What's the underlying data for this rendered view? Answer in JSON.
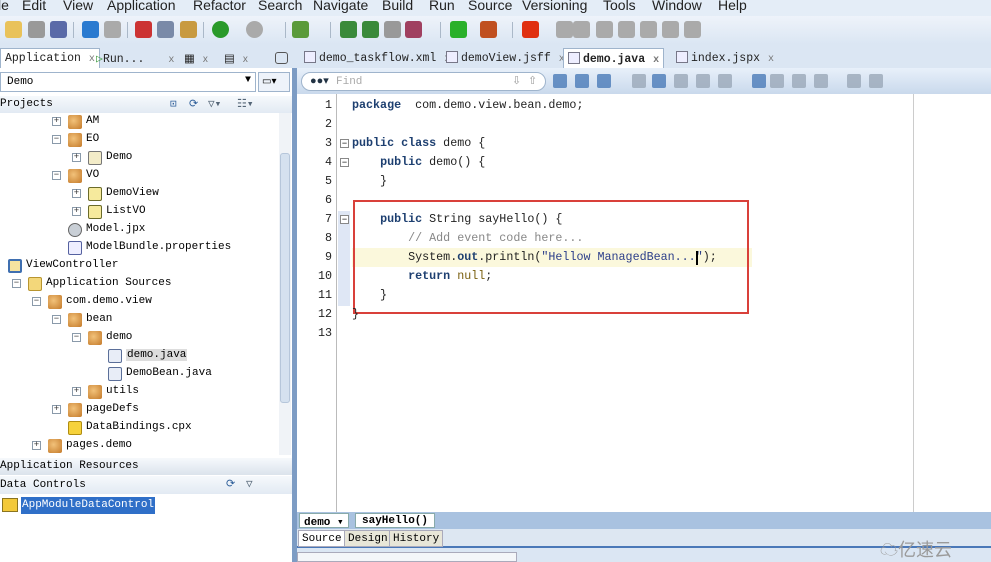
{
  "menubar": {
    "items": [
      "le",
      "Edit",
      "View",
      "Application",
      "Refactor",
      "Search",
      "Navigate",
      "Build",
      "Run",
      "Source",
      "Versioning",
      "Tools",
      "Window",
      "Help"
    ]
  },
  "toolbar": {
    "icons": [
      "open-icon",
      "save-icon",
      "save-all-icon",
      "undo-icon",
      "redo-icon",
      "cut-icon",
      "copy-icon",
      "paste-icon",
      "back-icon",
      "forward-icon",
      "sql-icon",
      "deploy-icon",
      "deploy-all-icon",
      "build-icon",
      "debug-profile-icon",
      "run-icon",
      "debug-icon",
      "stop-icon",
      "step-icon",
      "step-over-icon",
      "step-into-icon",
      "step-out-icon",
      "resume-icon",
      "pause-icon",
      "trash-icon"
    ]
  },
  "left_panel": {
    "tabs": [
      {
        "label": "Application"
      },
      {
        "label": "Run..."
      }
    ],
    "app_selector": "Demo",
    "projects_label": "Projects",
    "tree": [
      {
        "level": 3,
        "exp": "+",
        "icon": "pkg",
        "label": "AM"
      },
      {
        "level": 3,
        "exp": "-",
        "icon": "pkg",
        "label": "EO"
      },
      {
        "level": 4,
        "exp": "+",
        "icon": "eo",
        "label": "Demo"
      },
      {
        "level": 3,
        "exp": "-",
        "icon": "pkg",
        "label": "VO"
      },
      {
        "level": 4,
        "exp": "+",
        "icon": "view",
        "label": "DemoView"
      },
      {
        "level": 4,
        "exp": "+",
        "icon": "view",
        "label": "ListVO"
      },
      {
        "level": 3,
        "exp": "",
        "icon": "gear",
        "label": "Model.jpx"
      },
      {
        "level": 3,
        "exp": "",
        "icon": "props",
        "label": "ModelBundle.properties"
      },
      {
        "level": 0,
        "exp": "",
        "icon": "proj",
        "label": "ViewController"
      },
      {
        "level": 1,
        "exp": "-",
        "icon": "folder",
        "label": "Application Sources"
      },
      {
        "level": 2,
        "exp": "-",
        "icon": "pkg",
        "label": "com.demo.view"
      },
      {
        "level": 3,
        "exp": "-",
        "icon": "pkg",
        "label": "bean"
      },
      {
        "level": 4,
        "exp": "-",
        "icon": "pkg",
        "label": "demo"
      },
      {
        "level": 5,
        "exp": "",
        "icon": "java",
        "label": "demo.java",
        "selected": true
      },
      {
        "level": 5,
        "exp": "",
        "icon": "java",
        "label": "DemoBean.java"
      },
      {
        "level": 4,
        "exp": "+",
        "icon": "pkg",
        "label": "utils"
      },
      {
        "level": 3,
        "exp": "+",
        "icon": "pkg",
        "label": "pageDefs"
      },
      {
        "level": 3,
        "exp": "",
        "icon": "cpx",
        "label": "DataBindings.cpx"
      },
      {
        "level": 2,
        "exp": "+",
        "icon": "pkg",
        "label": "pages.demo"
      }
    ],
    "app_resources_label": "Application Resources",
    "data_controls_label": "Data Controls",
    "data_control_item": "AppModuleDataControl"
  },
  "editor": {
    "tabs": [
      {
        "label": "demo_taskflow.xml"
      },
      {
        "label": "demoView.jsff"
      },
      {
        "label": "demo.java",
        "active": true
      },
      {
        "label": "index.jspx"
      }
    ],
    "find_placeholder": "Find",
    "lines": [
      [
        [
          "kw",
          "package"
        ],
        [
          "",
          "  com.demo.view.bean.demo;"
        ]
      ],
      [],
      [
        [
          "kw",
          "public class"
        ],
        [
          "",
          " demo {"
        ]
      ],
      [
        [
          "",
          "    "
        ],
        [
          "kw",
          "public"
        ],
        [
          "",
          " demo() {"
        ]
      ],
      [
        [
          "",
          "    }"
        ]
      ],
      [],
      [
        [
          "",
          "    "
        ],
        [
          "kw",
          "public"
        ],
        [
          "",
          " String sayHello() {"
        ]
      ],
      [
        [
          "",
          "        "
        ],
        [
          "cm",
          "// Add event code here..."
        ]
      ],
      [
        [
          "",
          "        System."
        ],
        [
          "kw",
          "out"
        ],
        [
          "",
          ".println("
        ],
        [
          "st",
          "\"Hellow ManagedBean...\""
        ],
        [
          "",
          ");"
        ]
      ],
      [
        [
          "",
          "        "
        ],
        [
          "kw",
          "return"
        ],
        [
          "",
          " "
        ],
        [
          "nl",
          "null"
        ],
        [
          "",
          ";"
        ]
      ],
      [
        [
          "",
          "    }"
        ]
      ],
      [
        [
          "",
          "}"
        ]
      ],
      []
    ],
    "breadcrumb": [
      "demo",
      "sayHello()"
    ],
    "bottom_tabs": [
      "Source",
      "Design",
      "History"
    ],
    "highlight_color": "#d9403a"
  },
  "watermark": "亿速云"
}
